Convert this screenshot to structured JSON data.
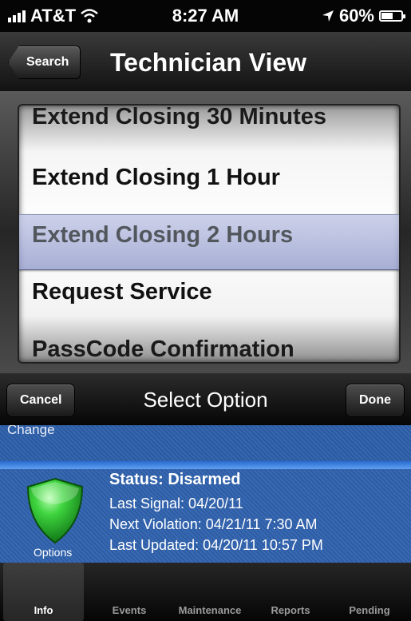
{
  "status_bar": {
    "carrier": "AT&T",
    "time": "8:27 AM",
    "battery": "60%",
    "battery_level": 0.6
  },
  "nav": {
    "back_label": "Search",
    "title": "Technician View"
  },
  "picker": {
    "items": [
      "Extend Closing 30 Minutes",
      "Extend Closing 1 Hour",
      "Extend Closing 2 Hours",
      "Request Service",
      "PassCode Confirmation"
    ],
    "selected": "Extend Closing 2 Hours"
  },
  "toolbar": {
    "cancel_label": "Cancel",
    "title": "Select Option",
    "done_label": "Done"
  },
  "content": {
    "partial_label": "Change",
    "status_title": "Status: Disarmed",
    "last_signal": "Last Signal: 04/20/11",
    "next_violation": "Next Violation: 04/21/11 7:30 AM",
    "last_updated": "Last Updated: 04/20/11 10:57 PM",
    "options_label": "Options"
  },
  "tabs": [
    {
      "label": "Info",
      "active": true
    },
    {
      "label": "Events",
      "active": false
    },
    {
      "label": "Maintenance",
      "active": false
    },
    {
      "label": "Reports",
      "active": false
    },
    {
      "label": "Pending",
      "active": false
    }
  ],
  "colors": {
    "panel_blue": "#3366aa",
    "shield_green": "#2fbf2f"
  }
}
